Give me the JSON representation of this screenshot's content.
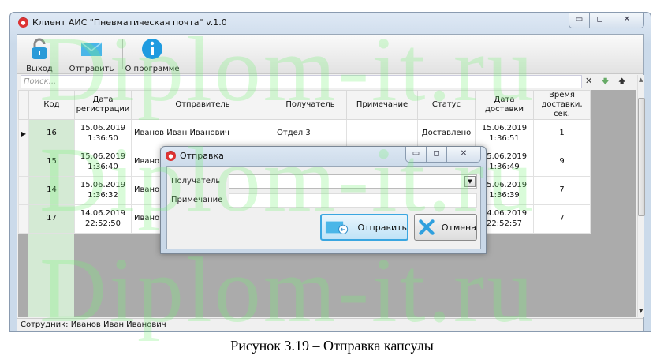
{
  "window": {
    "title": "Клиент АИС \"Пневматическая почта\" v.1.0",
    "minimize": "▭",
    "maximize": "◻",
    "close": "✕"
  },
  "toolbar": {
    "exit": "Выход",
    "send": "Отправить",
    "about": "О программе"
  },
  "search": {
    "placeholder": "Поиск...",
    "clear": "✕",
    "down": "🡇",
    "up": "🡅"
  },
  "table": {
    "columns": [
      "Код",
      "Дата регистрации",
      "Отправитель",
      "Получатель",
      "Примечание",
      "Статус",
      "Дата доставки",
      "Время доставки, сек."
    ],
    "rows": [
      {
        "kod": "16",
        "reg": [
          "15.06.2019",
          "1:36:50"
        ],
        "sender": "Иванов Иван Иванович",
        "recipient": "Отдел 3",
        "note": "",
        "status": "Доставлено",
        "deliv": [
          "15.06.2019",
          "1:36:51"
        ],
        "time": "1"
      },
      {
        "kod": "15",
        "reg": [
          "15.06.2019",
          "1:36:40"
        ],
        "sender": "Иванов",
        "recipient": "",
        "note": "",
        "status": "",
        "deliv": [
          "15.06.2019",
          "1:36:49"
        ],
        "time": "9"
      },
      {
        "kod": "14",
        "reg": [
          "15.06.2019",
          "1:36:32"
        ],
        "sender": "Иванов",
        "recipient": "",
        "note": "",
        "status": "",
        "deliv": [
          "15.06.2019",
          "1:36:39"
        ],
        "time": "7"
      },
      {
        "kod": "17",
        "reg": [
          "14.06.2019",
          "22:52:50"
        ],
        "sender": "Иванов",
        "recipient": "",
        "note": "",
        "status": "",
        "deliv": [
          "14.06.2019",
          "22:52:57"
        ],
        "time": "7"
      }
    ]
  },
  "statusbar": {
    "text": "Сотрудник: Иванов Иван Иванович"
  },
  "dialog": {
    "title": "Отправка",
    "recipient_label": "Получатель",
    "recipient_value": "",
    "note_label": "Примечание",
    "note_value": "",
    "send": "Отправить",
    "cancel": "Отмена"
  },
  "watermark": "Diplom-it.ru",
  "caption": "Рисунок 3.19 –   Отправка капсулы",
  "colors": {
    "kod_column": "#d4ead4",
    "watermark": "#78f078"
  }
}
